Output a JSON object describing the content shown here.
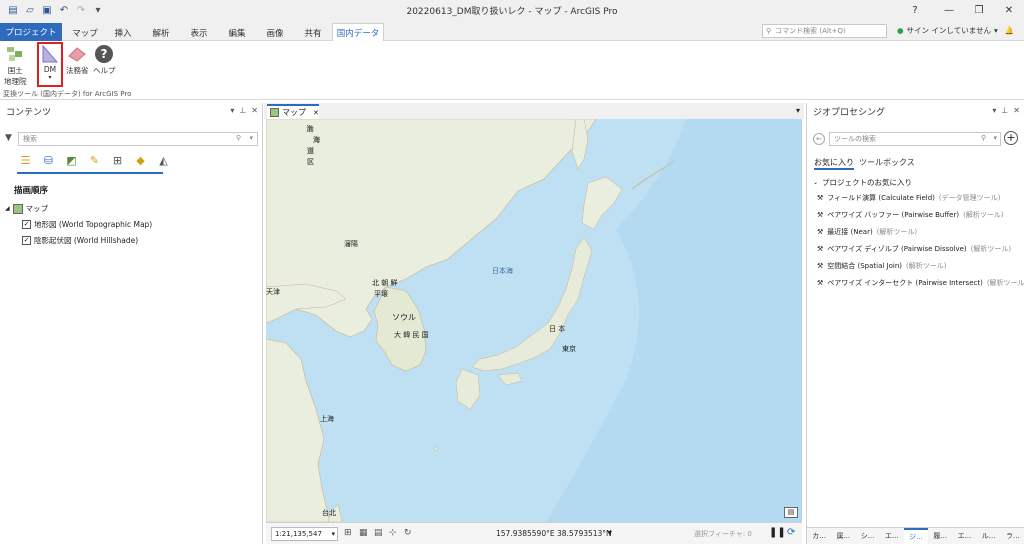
{
  "window": {
    "title": "20220613_DM取り扱いレク - マップ - ArcGIS Pro",
    "help": "?",
    "minimize": "—",
    "restore": "❐",
    "close": "✕"
  },
  "tabs": [
    {
      "label": "プロジェクト"
    },
    {
      "label": "マップ"
    },
    {
      "label": "挿入"
    },
    {
      "label": "解析"
    },
    {
      "label": "表示"
    },
    {
      "label": "編集"
    },
    {
      "label": "画像"
    },
    {
      "label": "共有"
    },
    {
      "label": "国内データ"
    }
  ],
  "command_search": {
    "placeholder": "コマンド検索 (Alt+Q)"
  },
  "signin": {
    "label": "サイン インしていません"
  },
  "ribbon": {
    "buttons": [
      {
        "label1": "国土",
        "label2": "地理院"
      },
      {
        "label1": "DM",
        "label2": ""
      },
      {
        "label1": "法務省",
        "label2": ""
      },
      {
        "label1": "ヘルプ",
        "label2": ""
      }
    ],
    "group_label": "変換ツール (国内データ) for ArcGIS Pro"
  },
  "contents": {
    "title": "コンテンツ",
    "search_placeholder": "検索",
    "draw_order": "描画順序",
    "map_label": "マップ",
    "layers": [
      {
        "label": "地形図 (World Topographic Map)",
        "checked": true
      },
      {
        "label": "陰影起伏図 (World Hillshade)",
        "checked": true
      }
    ]
  },
  "map_view": {
    "tab_label": "マップ",
    "places": {
      "bokkai": "渤",
      "haidou": "海",
      "kuni1": "道",
      "kuni2": "区",
      "shenyang": "瀋陽",
      "tianjin": "天津",
      "north_korea": "北 朝 鮮",
      "pyongyang": "平壌",
      "seoul": "ソウル",
      "south_korea": "大 韓 民 国",
      "sea_of_japan": "日本海",
      "japan": "日 本",
      "tokyo": "東京",
      "shanghai": "上海",
      "taipei": "台北"
    },
    "scale": "1:21,135,547",
    "coordinates": "157.9385590°E 38.5793513°N",
    "selected_features": "選択フィーチャ: 0"
  },
  "geoprocessing": {
    "title": "ジオプロセシング",
    "search_placeholder": "ツールの検索",
    "tab_favorites": "お気に入り",
    "tab_toolboxes": "ツールボックス",
    "section": "プロジェクトのお気に入り",
    "tools": [
      {
        "name": "フィールド演算 (Calculate Field)",
        "category": "(データ管理ツール)"
      },
      {
        "name": "ペアワイズ バッファー (Pairwise Buffer)",
        "category": "(解析ツール)"
      },
      {
        "name": "最近接 (Near)",
        "category": "(解析ツール)"
      },
      {
        "name": "ペアワイズ ディゾルブ (Pairwise Dissolve)",
        "category": "(解析ツール)"
      },
      {
        "name": "空間結合 (Spatial Join)",
        "category": "(解析ツール)"
      },
      {
        "name": "ペアワイズ インターセクト (Pairwise Intersect)",
        "category": "(解析ツール)"
      }
    ],
    "bottom_tabs": [
      "カ...",
      "属...",
      "シ...",
      "エ...",
      "ジ...",
      "履...",
      "エ...",
      "ル...",
      "ラ..."
    ]
  },
  "colors": {
    "accent": "#2e6bbd",
    "highlight": "#e02020",
    "ocean": "#bfe0f3",
    "land": "#e9eedf"
  }
}
